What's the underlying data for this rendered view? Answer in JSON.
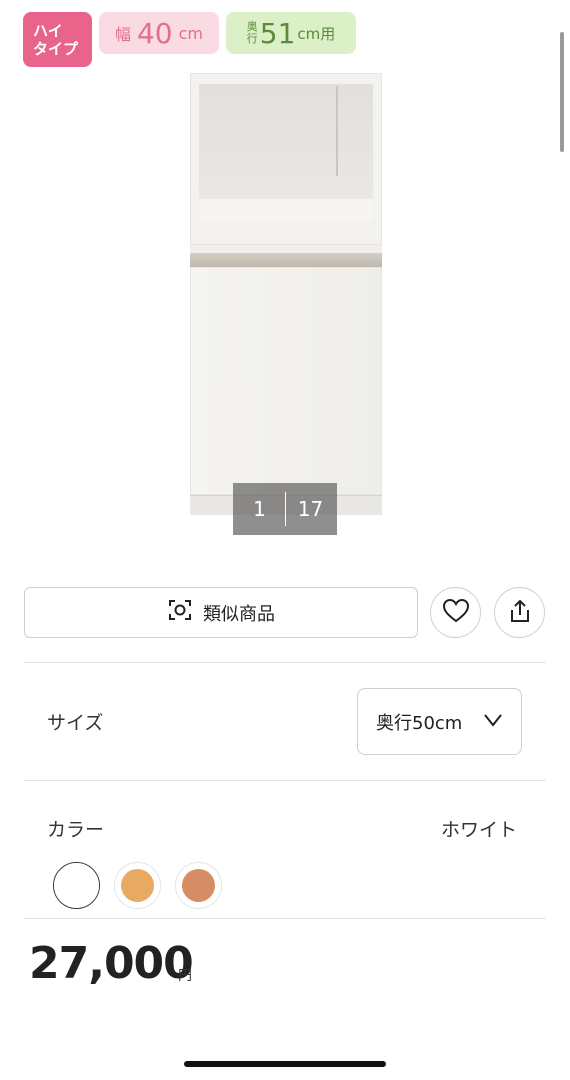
{
  "badges": {
    "type": {
      "line1": "ハイ",
      "line2": "タイプ",
      "color": "#e8648a"
    },
    "width": {
      "prefix": "幅",
      "value": "40",
      "unit": "cm",
      "color": "#fbdbe3"
    },
    "depth": {
      "prefix_top": "奥",
      "prefix_bottom": "行",
      "value": "51",
      "unit": "cm用",
      "color": "#dcf0c8"
    }
  },
  "gallery": {
    "current": "1",
    "total": "17"
  },
  "actions": {
    "similar_label": "類似商品",
    "similar_icon": "camera-scan-icon",
    "favorite_icon": "heart-icon",
    "share_icon": "share-icon"
  },
  "size": {
    "label": "サイズ",
    "selected": "奥行50cm"
  },
  "color": {
    "label": "カラー",
    "selected_name": "ホワイト",
    "swatches": [
      {
        "name": "white",
        "hex": "#ffffff",
        "selected": true
      },
      {
        "name": "light-wood",
        "hex": "#e8a962",
        "selected": false
      },
      {
        "name": "medium-wood",
        "hex": "#d68c64",
        "selected": false
      }
    ]
  },
  "price": {
    "amount": "27,000",
    "unit": "円"
  }
}
